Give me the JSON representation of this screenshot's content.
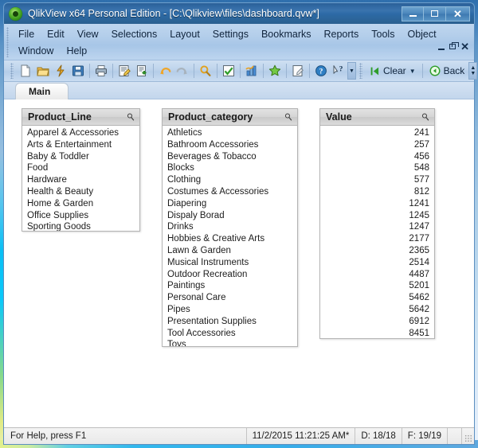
{
  "window": {
    "title": "QlikView x64 Personal Edition - [C:\\Qlikview\\files\\dashboard.qvw*]",
    "logo_icon": "qlikview-logo-icon",
    "controls": {
      "minimize": "minimize-icon",
      "maximize": "maximize-icon",
      "close": "close-icon"
    }
  },
  "menu": {
    "row1": [
      "File",
      "Edit",
      "View",
      "Selections",
      "Layout",
      "Settings",
      "Bookmarks",
      "Reports",
      "Tools",
      "Object"
    ],
    "row2": [
      "Window",
      "Help"
    ],
    "mdi_controls": {
      "minimize": "mdi-minimize-icon",
      "restore": "mdi-restore-icon",
      "close": "mdi-close-icon"
    }
  },
  "toolbar": {
    "icons": [
      "new-document-icon",
      "open-folder-icon",
      "reload-icon",
      "save-icon",
      "print-icon",
      "edit-script-icon",
      "export-icon",
      "undo-icon",
      "redo-icon",
      "search-icon",
      "current-selections-icon",
      "chart-icon",
      "bookmark-star-icon",
      "notes-icon",
      "help-icon",
      "context-help-icon"
    ],
    "clear_label": "Clear",
    "clear_icon": "clear-icon",
    "clear_dropdown_icon": "chevron-down-icon",
    "back_label": "Back",
    "back_icon": "back-arrow-icon",
    "overflow_icon": "toolbar-overflow-icon"
  },
  "tabs": [
    {
      "label": "Main",
      "active": true
    }
  ],
  "listboxes": [
    {
      "id": "product-line",
      "title": "Product_Line",
      "search_icon": "magnifier-icon",
      "align": "left",
      "items": [
        "Apparel & Accessories",
        "Arts & Entertainment",
        "Baby & Toddler",
        "Food",
        "Hardware",
        "Health & Beauty",
        "Home & Garden",
        "Office Supplies",
        "Sporting Goods"
      ]
    },
    {
      "id": "product-category",
      "title": "Product_category",
      "search_icon": "magnifier-icon",
      "align": "left",
      "items": [
        "Athletics",
        "Bathroom Accessories",
        "Beverages & Tobacco",
        "Blocks",
        "Clothing",
        "Costumes & Accessories",
        "Diapering",
        "Dispaly Borad",
        "Drinks",
        "Hobbies & Creative Arts",
        "Lawn & Garden",
        "Musical Instruments",
        "Outdoor Recreation",
        "Paintings",
        "Personal Care",
        "Pipes",
        "Presentation Supplies",
        "Tool Accessories",
        "Toys"
      ]
    },
    {
      "id": "value",
      "title": "Value",
      "search_icon": "magnifier-icon",
      "align": "right",
      "items": [
        "241",
        "257",
        "456",
        "548",
        "577",
        "812",
        "1241",
        "1245",
        "1247",
        "2177",
        "2365",
        "2514",
        "4487",
        "5201",
        "5462",
        "5642",
        "6912",
        "8451"
      ]
    }
  ],
  "status_bar": {
    "help_text": "For Help, press F1",
    "timestamp": "11/2/2015 11:21:25 AM*",
    "documents": "D: 18/18",
    "fields": "F: 19/19",
    "resize_grip_icon": "resize-grip-icon"
  },
  "colors": {
    "title_bar": "#2d6aa6",
    "menu_bar": "#b2cdea",
    "accent_glass_cyan": "#00bef5",
    "accent_glass_yellow": "#e1ec8c",
    "listbox_header": "#d6d6d6"
  }
}
